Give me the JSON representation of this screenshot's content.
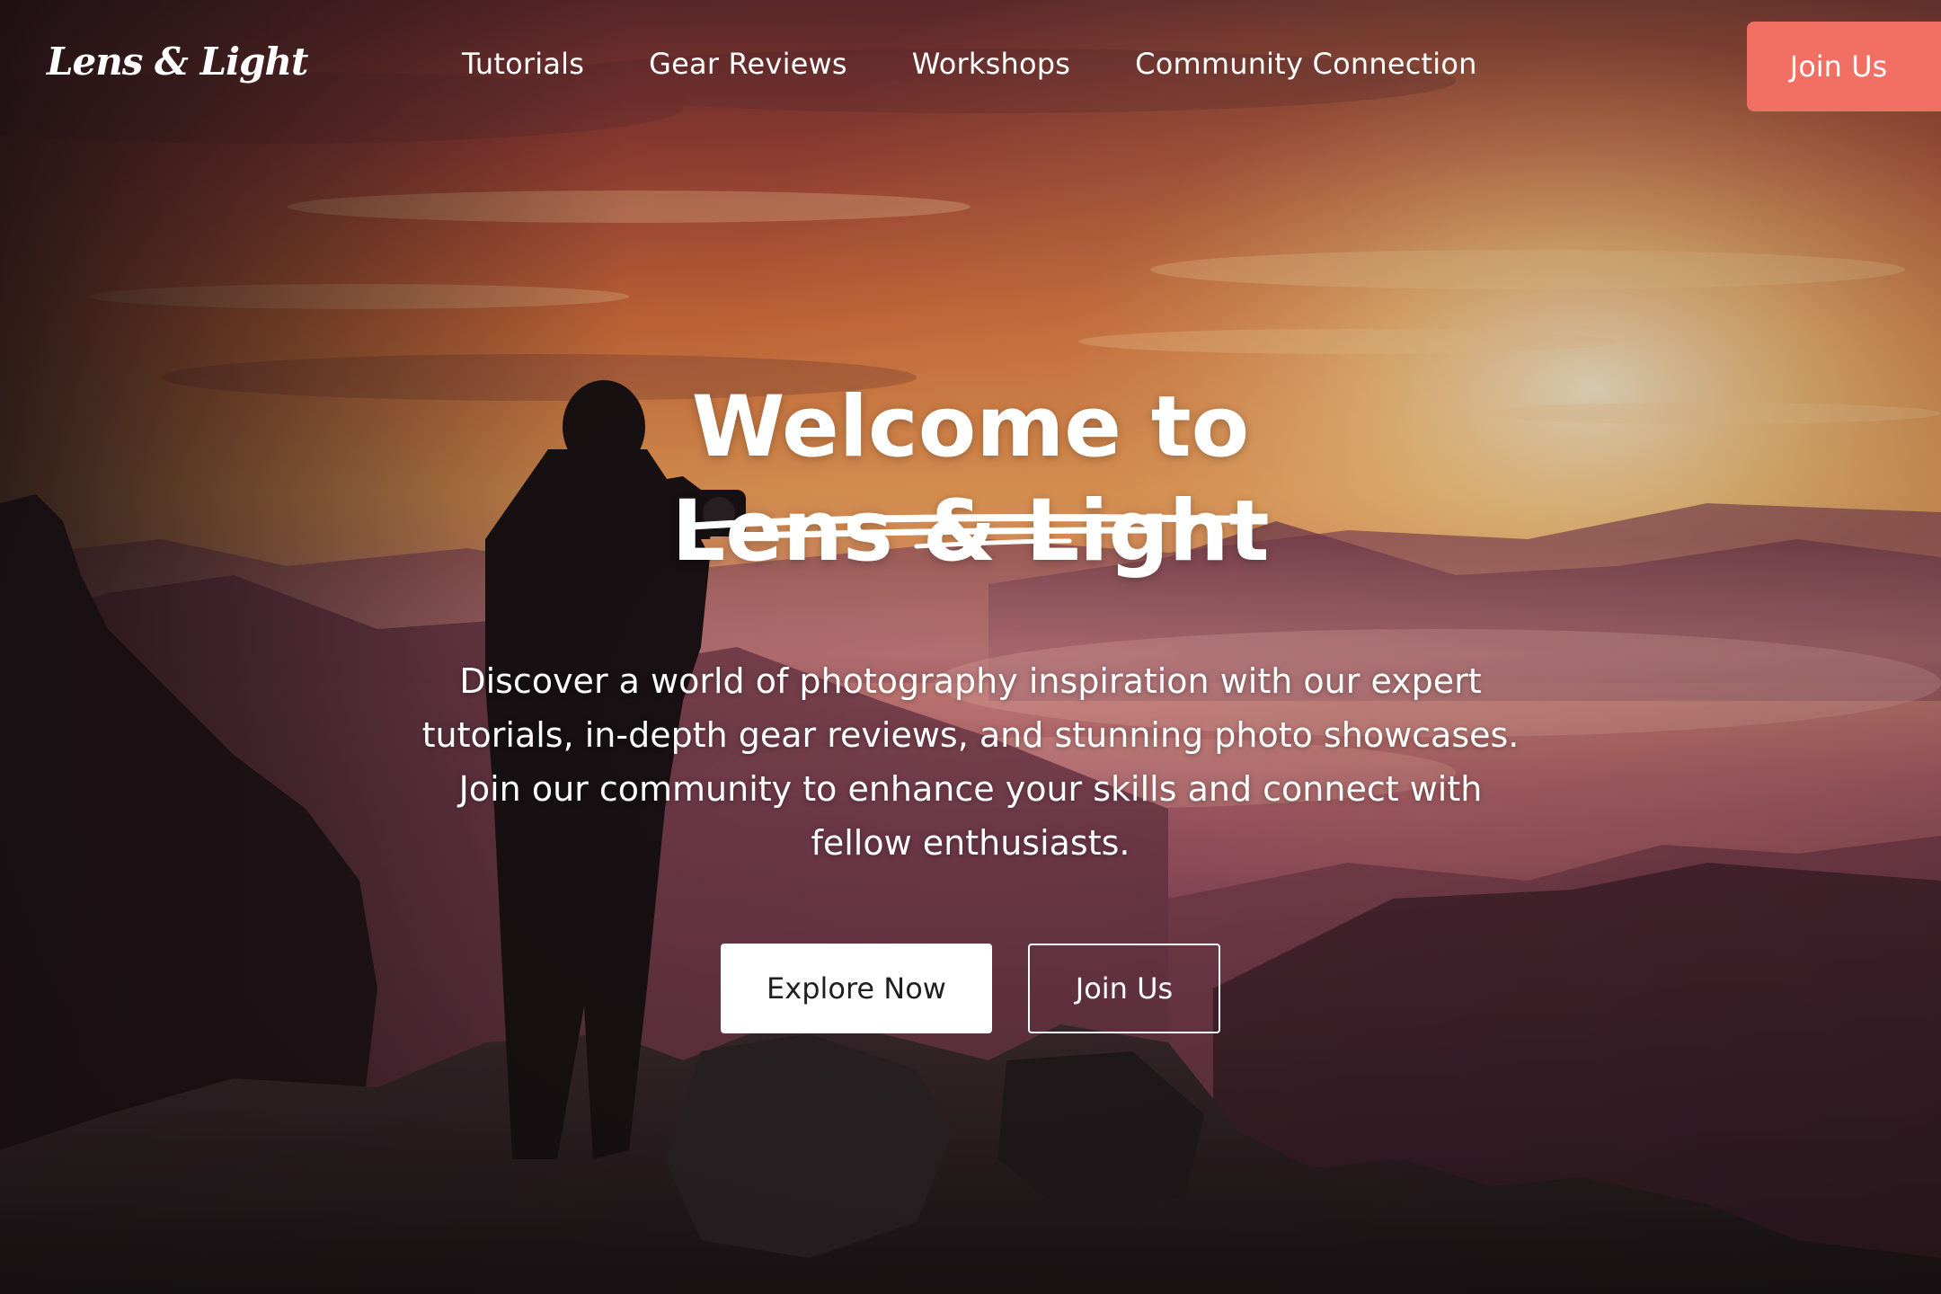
{
  "brand": {
    "logo": "Lens & Light"
  },
  "nav": {
    "links": [
      "Tutorials",
      "Gear Reviews",
      "Workshops",
      "Community Connection"
    ],
    "cta_label": "Join Us"
  },
  "hero": {
    "headline_line1": "Welcome to",
    "headline_line2": "Lens & Light",
    "description": "Discover a world of photography inspiration with our expert tutorials, in-depth gear reviews, and stunning photo showcases. Join our community to enhance your skills and connect with fellow enthusiasts.",
    "primary_button": "Explore Now",
    "secondary_button": "Join Us"
  },
  "colors": {
    "accent": "#f26f63",
    "text": "#ffffff",
    "button_text": "#1f1f1f"
  }
}
